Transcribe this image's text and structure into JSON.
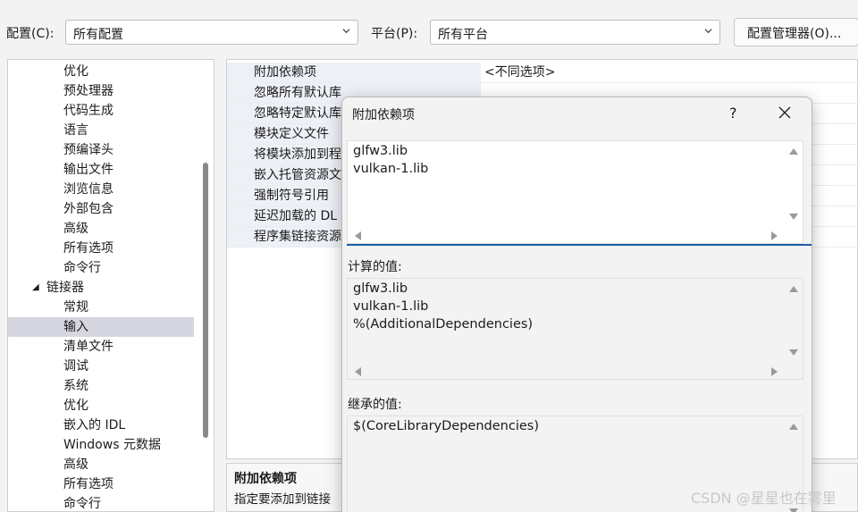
{
  "topbar": {
    "config_label": "配置(C):",
    "config_value": "所有配置",
    "platform_label": "平台(P):",
    "platform_value": "所有平台",
    "config_manager_button": "配置管理器(O)..."
  },
  "tree": {
    "items": [
      {
        "label": "优化"
      },
      {
        "label": "预处理器"
      },
      {
        "label": "代码生成"
      },
      {
        "label": "语言"
      },
      {
        "label": "预编译头"
      },
      {
        "label": "输出文件"
      },
      {
        "label": "浏览信息"
      },
      {
        "label": "外部包含"
      },
      {
        "label": "高级"
      },
      {
        "label": "所有选项"
      },
      {
        "label": "命令行"
      },
      {
        "label": "链接器",
        "caret": "◢"
      },
      {
        "label": "常规"
      },
      {
        "label": "输入"
      },
      {
        "label": "清单文件"
      },
      {
        "label": "调试"
      },
      {
        "label": "系统"
      },
      {
        "label": "优化"
      },
      {
        "label": "嵌入的 IDL"
      },
      {
        "label": "Windows 元数据"
      },
      {
        "label": "高级"
      },
      {
        "label": "所有选项"
      },
      {
        "label": "命令行"
      }
    ]
  },
  "properties": {
    "rows": [
      {
        "name": "附加依赖项",
        "value": "<不同选项>"
      },
      {
        "name": "忽略所有默认库",
        "value": ""
      },
      {
        "name": "忽略特定默认库",
        "value": ""
      },
      {
        "name": "模块定义文件",
        "value": ""
      },
      {
        "name": "将模块添加到程",
        "value": ""
      },
      {
        "name": "嵌入托管资源文",
        "value": ""
      },
      {
        "name": "强制符号引用",
        "value": ""
      },
      {
        "name": "延迟加载的 DL",
        "value": ""
      },
      {
        "name": "程序集链接资源",
        "value": ""
      }
    ]
  },
  "description": {
    "title": "附加依赖项",
    "text": "指定要添加到链接"
  },
  "dialog": {
    "title": "附加依赖项",
    "help": "?",
    "edit_lines": [
      "glfw3.lib",
      "vulkan-1.lib"
    ],
    "computed_label": "计算的值:",
    "computed_lines": [
      "glfw3.lib",
      "vulkan-1.lib",
      "%(AdditionalDependencies)"
    ],
    "inherited_label": "继承的值:",
    "inherited_lines": [
      "$(CoreLibraryDependencies)"
    ]
  },
  "watermark": "CSDN @星星也在雾里"
}
